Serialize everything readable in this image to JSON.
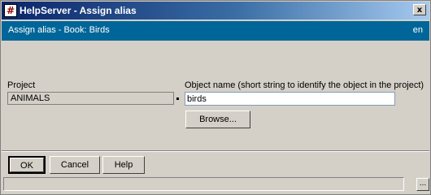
{
  "window": {
    "title": "HelpServer - Assign alias",
    "app_icon_glyph": "#",
    "close_glyph": "x"
  },
  "header": {
    "title": "Assign alias - Book: Birds",
    "language": "en",
    "background": "#006699"
  },
  "form": {
    "project_label": "Project",
    "project_value": "ANIMALS",
    "object_name_label": "Object name (short string to identify the object in the project)",
    "object_name_value": "birds",
    "browse_label": "Browse..."
  },
  "footer": {
    "ok_label": "OK",
    "cancel_label": "Cancel",
    "help_label": "Help",
    "more_label": "..."
  }
}
